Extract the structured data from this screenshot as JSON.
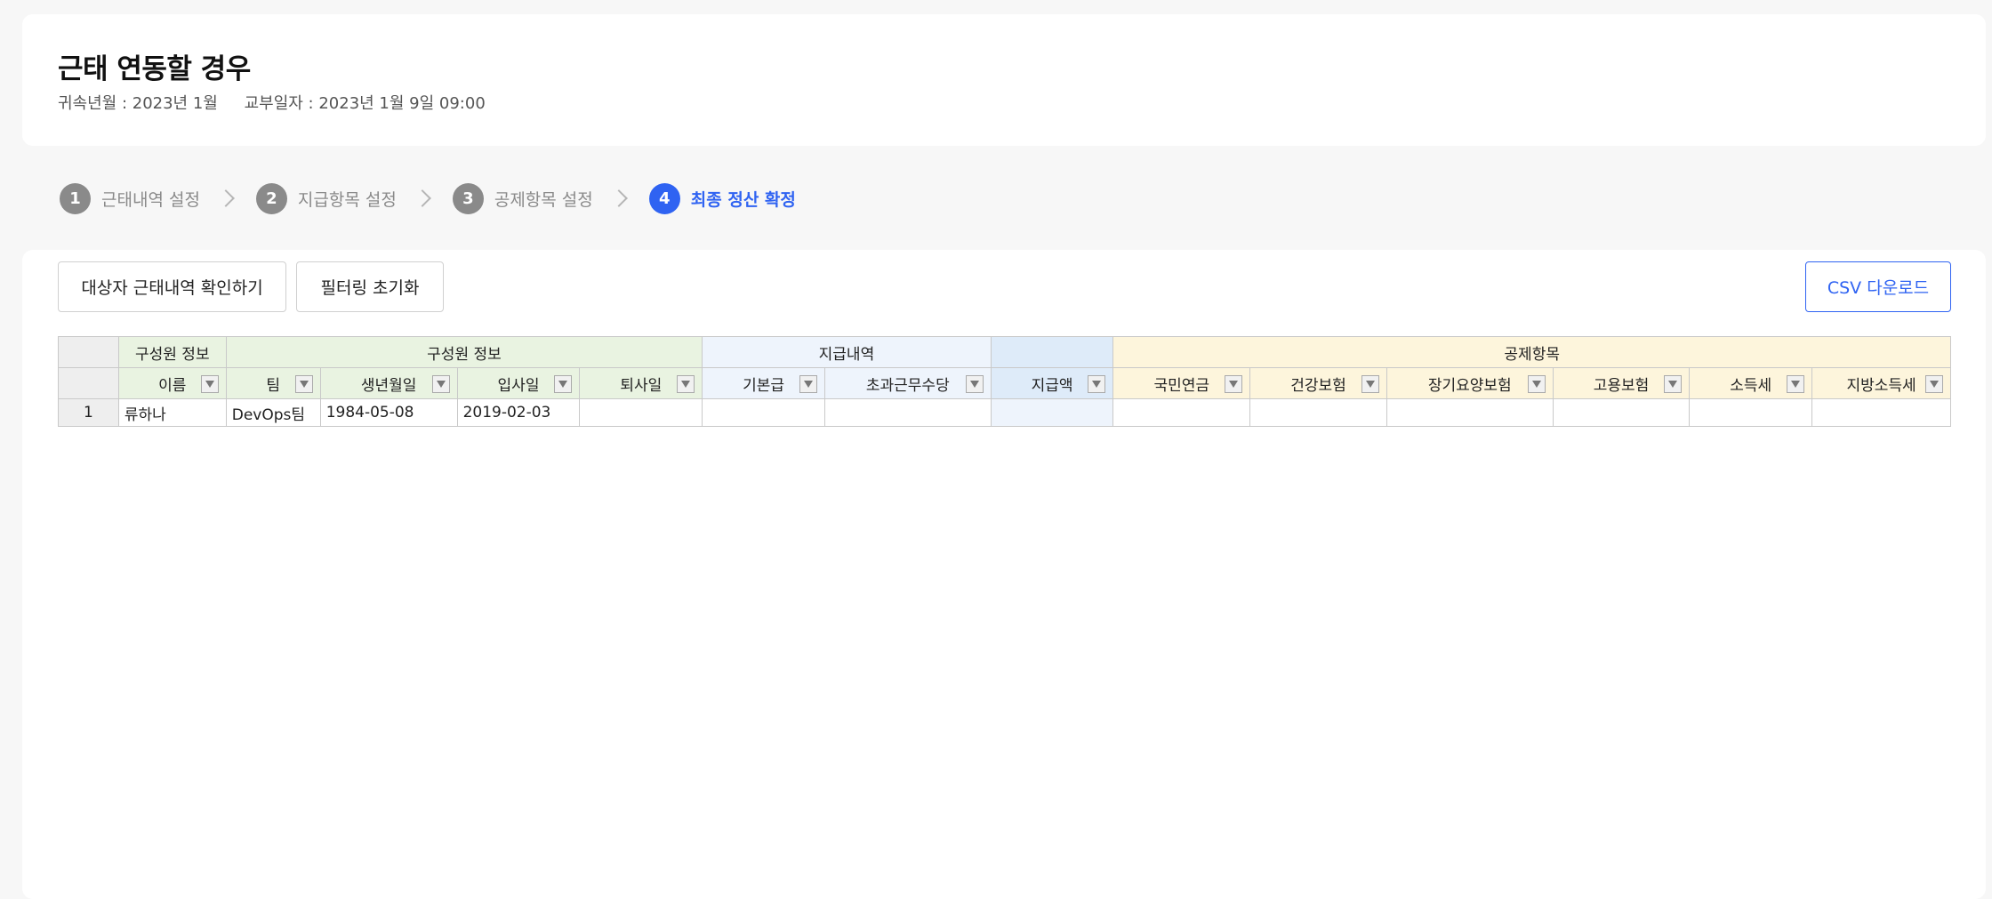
{
  "header": {
    "title": "근태 연동할 경우",
    "period": "귀속년월 : 2023년 1월",
    "issue_date": "교부일자 : 2023년 1월 9일 09:00"
  },
  "steps": [
    {
      "num": "1",
      "label": "근태내역 설정",
      "active": false
    },
    {
      "num": "2",
      "label": "지급항목 설정",
      "active": false
    },
    {
      "num": "3",
      "label": "공제항목 설정",
      "active": false
    },
    {
      "num": "4",
      "label": "최종 정산 확정",
      "active": true
    }
  ],
  "toolbar": {
    "check_attendance": "대상자 근태내역 확인하기",
    "reset_filter": "필터링 초기화",
    "csv_download": "CSV 다운로드"
  },
  "table": {
    "groups": {
      "member_info_1": "구성원 정보",
      "member_info_2": "구성원 정보",
      "payment": "지급내역",
      "deduction": "공제항목"
    },
    "columns": {
      "name": "이름",
      "team": "팀",
      "birth": "생년월일",
      "join": "입사일",
      "leave": "퇴사일",
      "base_pay": "기본급",
      "overtime": "초과근무수당",
      "pay_amount": "지급액",
      "pension": "국민연금",
      "health": "건강보험",
      "longterm": "장기요양보험",
      "employment": "고용보험",
      "income_tax": "소득세",
      "local_tax": "지방소득세"
    },
    "rows": [
      {
        "no": "1",
        "name": "류하나",
        "team": "DevOps팀",
        "birth": "1984-05-08",
        "join": "2019-02-03",
        "leave": "",
        "base_pay": "",
        "overtime": "",
        "pay_amount": "",
        "pension": "",
        "health": "",
        "longterm": "",
        "employment": "",
        "income_tax": "",
        "local_tax": ""
      }
    ]
  }
}
